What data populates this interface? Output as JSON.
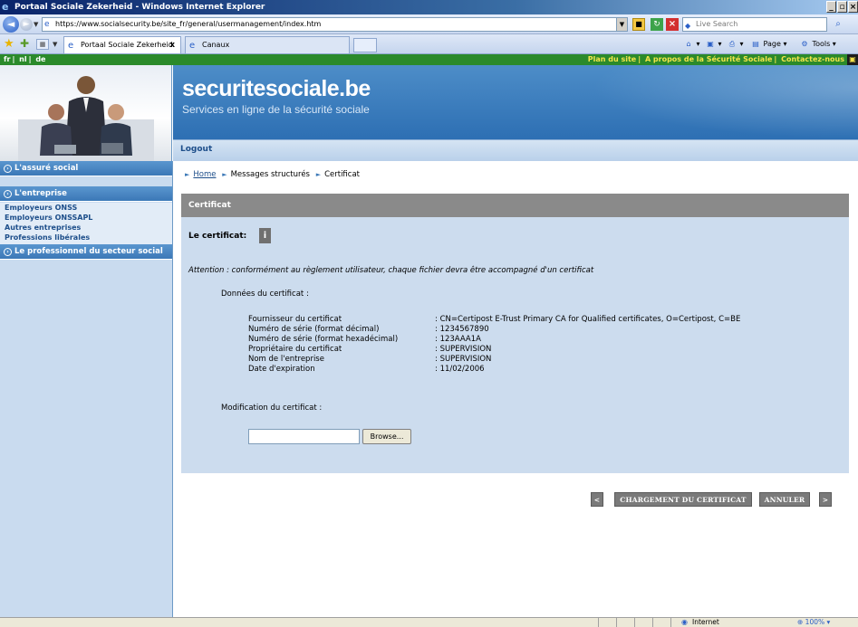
{
  "browser": {
    "window_title": "Portaal Sociale Zekerheid - Windows Internet Explorer",
    "address": "https://www.socialsecurity.be/site_fr/general/usermanagement/index.htm",
    "search_placeholder": "Live Search",
    "tabs": [
      {
        "label": "Portaal Sociale Zekerheid",
        "active": true
      },
      {
        "label": "Canaux",
        "active": false
      }
    ],
    "commands": {
      "page": "Page",
      "tools": "Tools"
    },
    "status": {
      "zone": "Internet",
      "zoom": "100%"
    }
  },
  "site": {
    "languages": [
      "fr",
      "nl",
      "de"
    ],
    "top_links": [
      "Plan du site",
      "A propos de la Sécurité Sociale",
      "Contactez-nous"
    ],
    "brand": "securitesociale.be",
    "tagline": "Services en ligne de la sécurité sociale",
    "logout": "Logout"
  },
  "sidebar": {
    "sections": [
      {
        "label": "L'assuré social"
      },
      {
        "label": "L'entreprise"
      },
      {
        "label": "Le professionnel du secteur social"
      }
    ],
    "entreprise_items": [
      "Employeurs ONSS",
      "Employeurs ONSSAPL",
      "Autres entreprises",
      "Professions libérales"
    ]
  },
  "breadcrumb": [
    "Home",
    "Messages structurés",
    "Certificat"
  ],
  "panel": {
    "title": "Certificat",
    "cert_label": "Le certificat:",
    "info_icon": "i",
    "warning": "Attention : conformément au règlement utilisateur, chaque fichier devra être accompagné d'un certificat",
    "details_title": "Données du certificat :",
    "details": [
      {
        "label": "Fournisseur du certificat",
        "value": ": CN=Certipost E-Trust Primary CA for Qualified certificates, O=Certipost, C=BE"
      },
      {
        "label": "Numéro de série (format décimal)",
        "value": ": 1234567890"
      },
      {
        "label": "Numéro de série (format hexadécimal)",
        "value": ": 123AAA1A"
      },
      {
        "label": "Propriétaire du certificat",
        "value": ": SUPERVISION"
      },
      {
        "label": "Nom de l'entreprise",
        "value": ": SUPERVISION"
      },
      {
        "label": "Date d'expiration",
        "value": ": 11/02/2006"
      }
    ],
    "modification_title": "Modification du certificat :",
    "file_value": "",
    "browse_label": "Browse..."
  },
  "actions": {
    "prev": "<",
    "upload": "CHARGEMENT DU CERTIFICAT",
    "cancel": "ANNULER",
    "next": ">"
  },
  "colors": {
    "site_green": "#2b8a2b",
    "banner_blue": "#2d6fb3",
    "panel_bg": "#ccdcee",
    "panel_header": "#8a8a8a",
    "button_grey": "#7a7a7a"
  }
}
